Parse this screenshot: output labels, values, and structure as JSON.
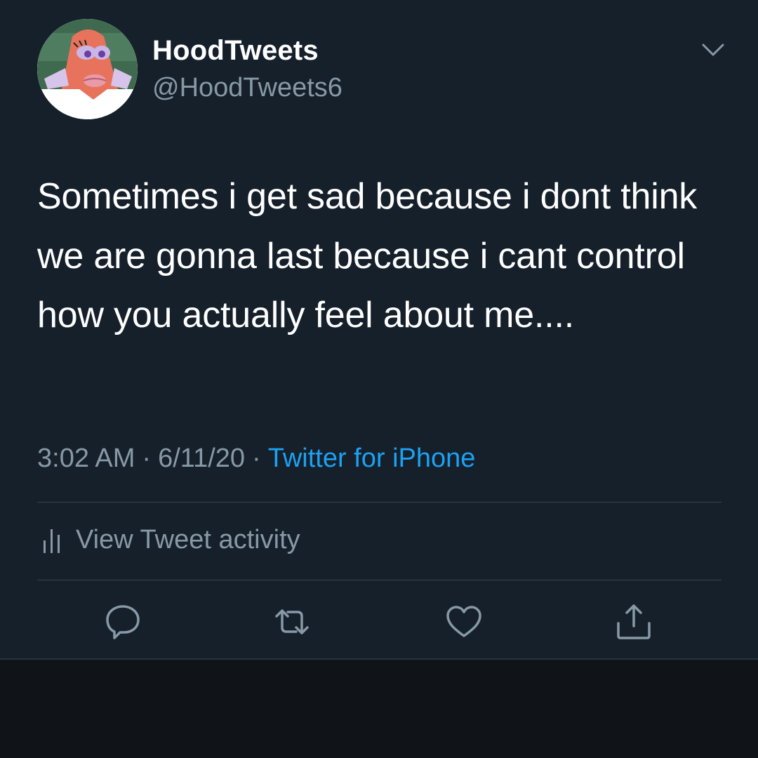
{
  "author": {
    "display_name": "HoodTweets",
    "handle": "@HoodTweets6",
    "avatar_icon": "avatar-image"
  },
  "tweet": {
    "text": "Sometimes i get sad because i dont think we are gonna last because i cant control how you actually feel about me....",
    "time": "3:02 AM",
    "separator": "·",
    "date": "6/11/20",
    "source": "Twitter for iPhone"
  },
  "activity": {
    "label": "View Tweet activity",
    "icon": "bar-chart-icon"
  },
  "actions": [
    {
      "name": "reply",
      "icon": "reply-icon"
    },
    {
      "name": "retweet",
      "icon": "retweet-icon"
    },
    {
      "name": "like",
      "icon": "heart-icon"
    },
    {
      "name": "share",
      "icon": "share-icon"
    }
  ],
  "colors": {
    "background": "#15202b",
    "text": "#ffffff",
    "secondary": "#8899a6",
    "accent": "#1da1f2",
    "divider": "#38444d"
  }
}
